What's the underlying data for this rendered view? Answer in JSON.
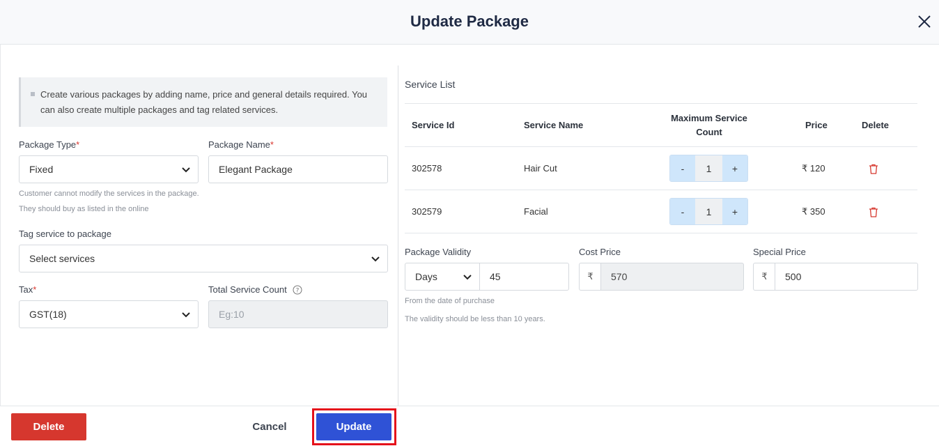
{
  "modal": {
    "title": "Update Package"
  },
  "info_text": "Create various packages by adding name, price and general details required. You can also create multiple packages and tag related services.",
  "package_type": {
    "label": "Package Type",
    "required_mark": "*",
    "value": "Fixed"
  },
  "package_name": {
    "label": "Package Name",
    "required_mark": "*",
    "value": "Elegant Package"
  },
  "package_type_hints": [
    "Customer cannot modify the services in the package.",
    "They should buy as listed in the online"
  ],
  "tag_service": {
    "label": "Tag service to package",
    "value": "Select services"
  },
  "tax": {
    "label": "Tax",
    "required_mark": "*",
    "value": "GST(18)"
  },
  "total_service_count": {
    "label": "Total Service Count",
    "placeholder": "Eg:10"
  },
  "service_list": {
    "title": "Service List",
    "headers": {
      "id": "Service Id",
      "name": "Service Name",
      "count": "Maximum Service Count",
      "price": "Price",
      "delete": "Delete"
    },
    "rows": [
      {
        "id": "302578",
        "name": "Hair Cut",
        "count": "1",
        "price": "₹ 120"
      },
      {
        "id": "302579",
        "name": "Facial",
        "count": "1",
        "price": "₹ 350"
      }
    ],
    "minus_label": "-",
    "plus_label": "+"
  },
  "validity": {
    "label": "Package Validity",
    "unit": "Days",
    "value": "45",
    "hints": [
      "From the date of purchase",
      "The validity should be less than 10 years."
    ]
  },
  "cost_price": {
    "label": "Cost Price",
    "currency": "₹",
    "value": "570"
  },
  "special_price": {
    "label": "Special Price",
    "currency": "₹",
    "value": "500"
  },
  "footer": {
    "delete_label": "Delete",
    "cancel_label": "Cancel",
    "update_label": "Update"
  },
  "colors": {
    "primary": "#2f52d6",
    "danger": "#d6372e",
    "highlight": "#e5101a"
  }
}
